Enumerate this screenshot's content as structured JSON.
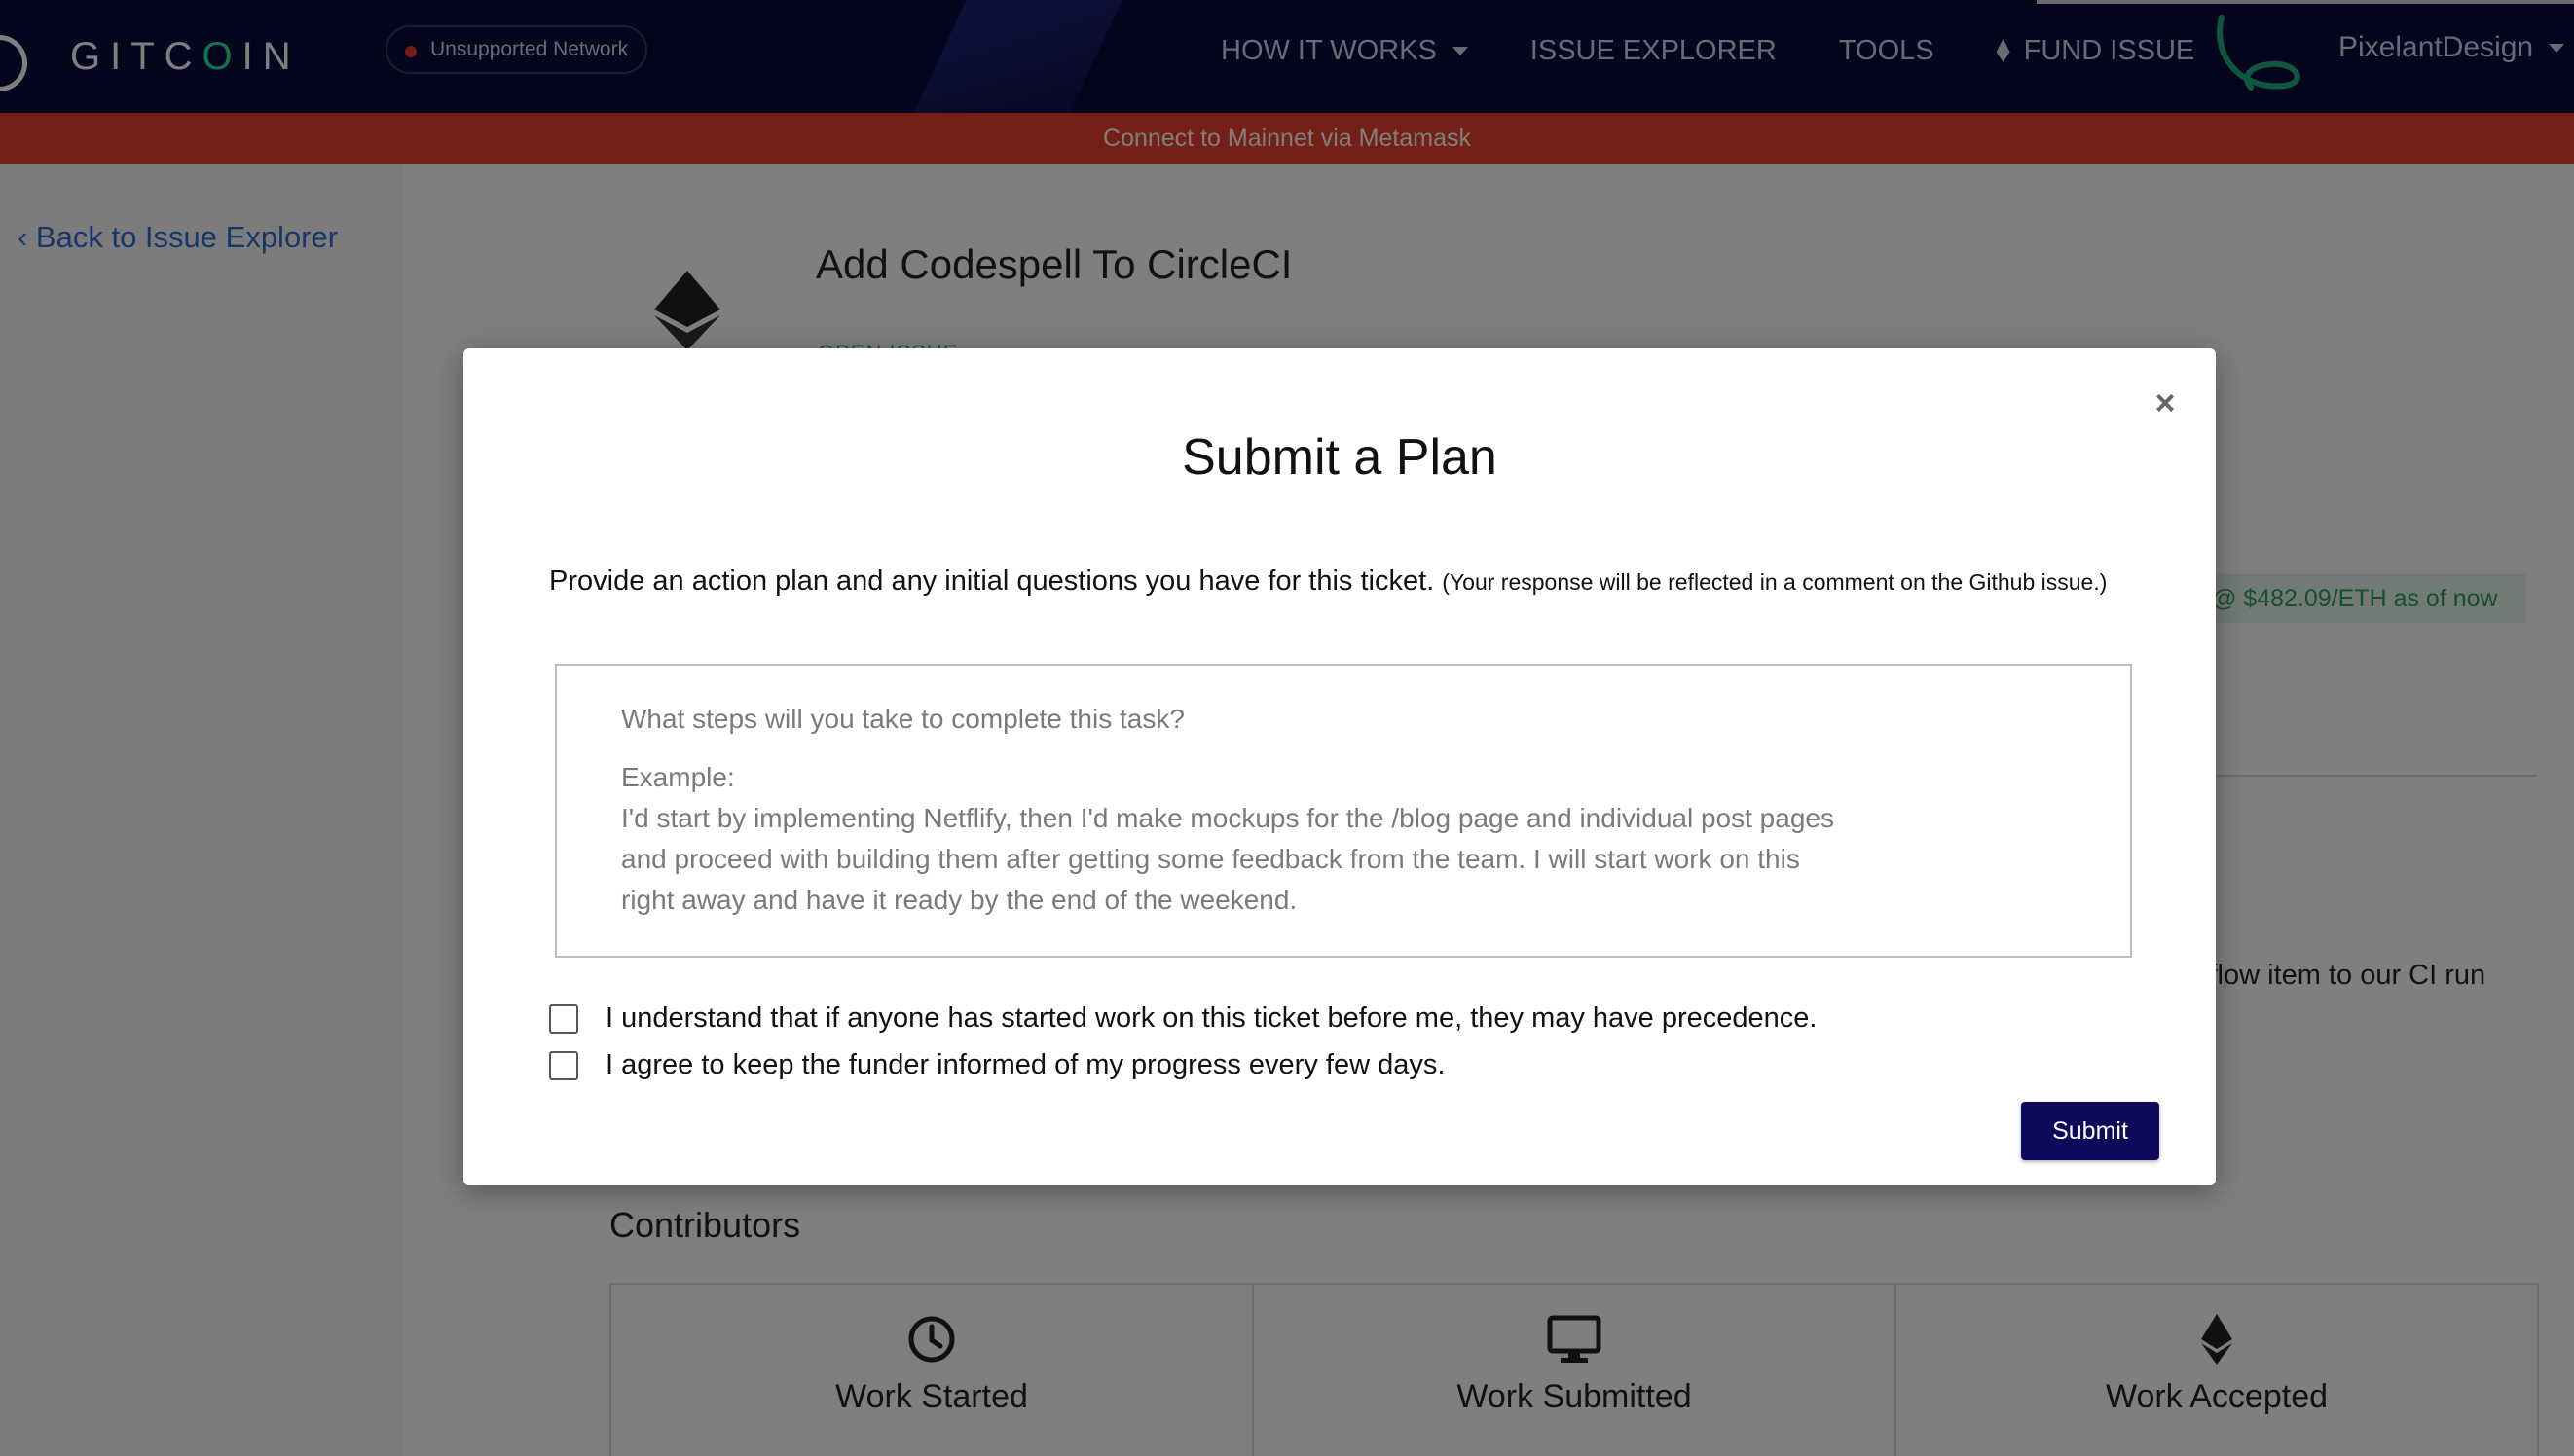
{
  "navbar": {
    "brand": {
      "prefix": "GITC",
      "accent": "O",
      "suffix": "IN"
    },
    "network_badge": "Unsupported Network",
    "links": [
      {
        "label": "HOW IT WORKS",
        "has_dropdown": true
      },
      {
        "label": "ISSUE EXPLORER"
      },
      {
        "label": "TOOLS"
      },
      {
        "label": "FUND ISSUE",
        "icon": "ethereum-icon"
      }
    ],
    "username": "PixelantDesign"
  },
  "banner": {
    "text": "Connect to Mainnet via Metamask"
  },
  "sidebar": {
    "back_link": "‹ Back to Issue Explorer"
  },
  "issue": {
    "title": "Add Codespell To CircleCI",
    "status": "OPEN ISSUE",
    "price": "@ $482.09/ETH  as of now",
    "description_fragment": "kflow item to our CI run"
  },
  "contributors": {
    "title": "Contributors",
    "stages": [
      {
        "label": "Work Started",
        "icon": "clock-icon"
      },
      {
        "label": "Work Submitted",
        "icon": "monitor-icon"
      },
      {
        "label": "Work Accepted",
        "icon": "ethereum-icon"
      }
    ]
  },
  "modal": {
    "title": "Submit a Plan",
    "close_label": "×",
    "lead": "Provide an action plan and any initial questions you have for this ticket.",
    "lead_note": "(Your response will be reflected in a comment on the Github issue.)",
    "textarea_question": "What steps will you take to complete this task?",
    "textarea_example_label": "Example:",
    "textarea_example": "I'd start by implementing Netflify, then I'd make mockups for the /blog page and individual post pages and proceed with building them after getting some feedback from the team. I will start work on this right away and have it ready by the end of the weekend.",
    "checkboxes": [
      {
        "label": "I understand that if anyone has started work on this ticket before me, they may have precedence.",
        "checked": false
      },
      {
        "label": "I agree to keep the funder informed of my progress every few days.",
        "checked": false
      }
    ],
    "submit_label": "Submit"
  },
  "colors": {
    "navbar_bg": "#0d0a3d",
    "banner_bg": "#e8402d",
    "brand_accent": "#25e899",
    "submit_bg": "#0e0a5c",
    "link": "#2f6fd6"
  }
}
